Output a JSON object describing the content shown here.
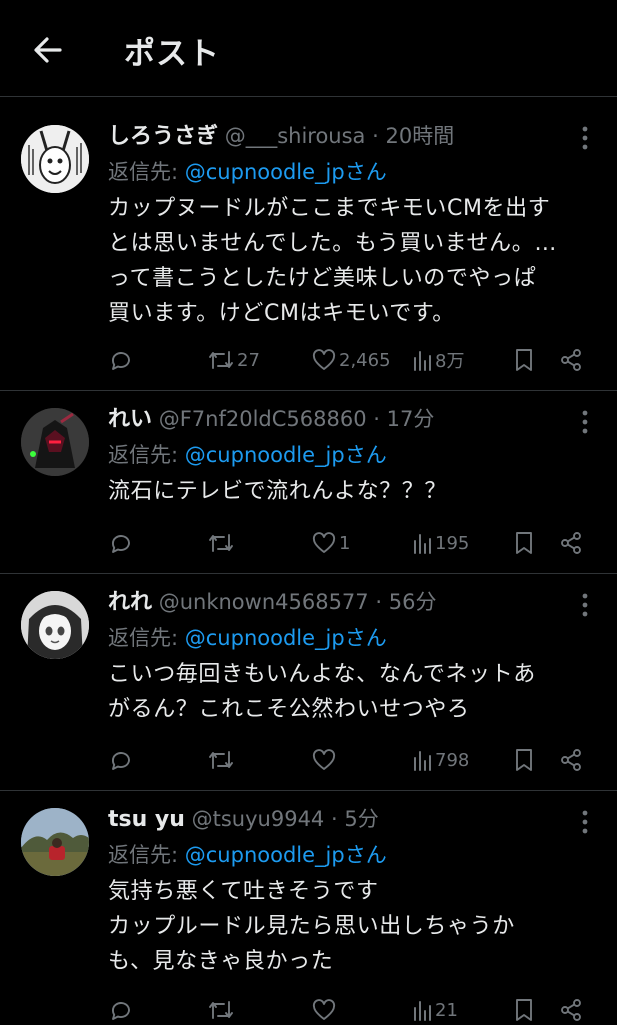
{
  "header": {
    "title": "ポスト"
  },
  "reply_prefix": "返信先: ",
  "posts": [
    {
      "name": "しろうさぎ",
      "handle": "@___shirousa",
      "dot": "·",
      "time": "20時間",
      "reply_to": "@cupnoodle_jpさん",
      "text_lines": [
        "カップヌードルがここまでキモいCMを出す",
        "とは思いませんでした。もう買いません。…",
        "って書こうとしたけど美味しいのでやっぱ",
        "買います。けどCMはキモいです。"
      ],
      "retweets": "27",
      "likes": "2,465",
      "views": "8万"
    },
    {
      "name": "れい",
      "handle": "@F7nf20ldC568860",
      "dot": "·",
      "time": "17分",
      "reply_to": "@cupnoodle_jpさん",
      "text_lines": [
        "流石にテレビで流れんよな？？？"
      ],
      "retweets": "",
      "likes": "1",
      "views": "195"
    },
    {
      "name": "れれ",
      "handle": "@unknown4568577",
      "dot": "·",
      "time": "56分",
      "reply_to": "@cupnoodle_jpさん",
      "text_lines": [
        "こいつ毎回きもいんよな、なんでネットあ",
        "がるん？これこそ公然わいせつやろ"
      ],
      "retweets": "",
      "likes": "",
      "views": "798"
    },
    {
      "name": "tsu yu",
      "handle": "@tsuyu9944",
      "dot": "·",
      "time": "5分",
      "reply_to": "@cupnoodle_jpさん",
      "text_lines": [
        "気持ち悪くて吐きそうです",
        "カップルードル見たら思い出しちゃうか",
        "も、見なきゃ良かった"
      ],
      "retweets": "",
      "likes": "",
      "views": "21"
    }
  ],
  "colors": {
    "background": "#000000",
    "text": "#e7e9ea",
    "muted": "#71767b",
    "link": "#1d9bf0",
    "divider": "#2f3336"
  }
}
